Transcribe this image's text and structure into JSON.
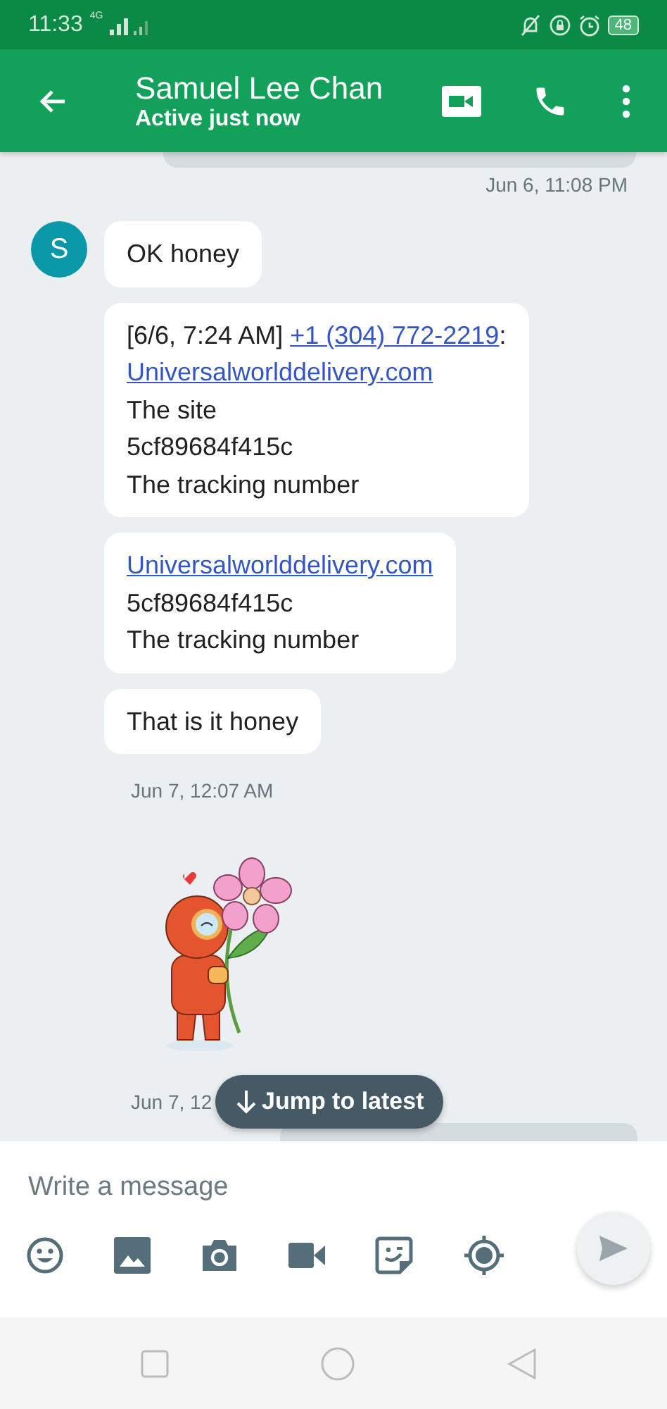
{
  "status_bar": {
    "time": "11:33",
    "network": "4G",
    "battery": "48"
  },
  "header": {
    "contact_name": "Samuel Lee Chan",
    "presence": "Active just now"
  },
  "messages": [
    {
      "kind": "cut-outgoing"
    },
    {
      "kind": "sent-time",
      "text": "Jun 6, 11:08 PM"
    },
    {
      "kind": "text",
      "avatar": "S",
      "lines": [
        [
          {
            "text": "OK honey",
            "link": false
          }
        ]
      ]
    },
    {
      "kind": "text",
      "lines": [
        [
          {
            "text": "[6/6, 7:24 AM] ",
            "link": false
          },
          {
            "text": "+1 (304) 772-2219",
            "link": true
          },
          {
            "text": ":",
            "link": false
          }
        ],
        [
          {
            "text": "Universalworlddelivery.com",
            "link": true
          }
        ],
        [
          {
            "text": "The site",
            "link": false
          }
        ],
        [
          {
            "text": "5cf89684f415c",
            "link": false
          }
        ],
        [
          {
            "text": "The tracking number",
            "link": false
          }
        ]
      ]
    },
    {
      "kind": "text",
      "lines": [
        [
          {
            "text": "Universalworlddelivery.com",
            "link": true
          }
        ],
        [
          {
            "text": "5cf89684f415c",
            "link": false
          }
        ],
        [
          {
            "text": "The tracking number",
            "link": false
          }
        ]
      ]
    },
    {
      "kind": "text",
      "lines": [
        [
          {
            "text": "That is it honey",
            "link": false
          }
        ]
      ]
    },
    {
      "kind": "received-time",
      "text": "Jun 7, 12:07 AM"
    },
    {
      "kind": "sticker"
    },
    {
      "kind": "received-time",
      "text": "Jun 7, 12"
    },
    {
      "kind": "cut-outgoing"
    }
  ],
  "jump_button": {
    "label": "Jump to latest"
  },
  "composer": {
    "placeholder": "Write a message"
  }
}
